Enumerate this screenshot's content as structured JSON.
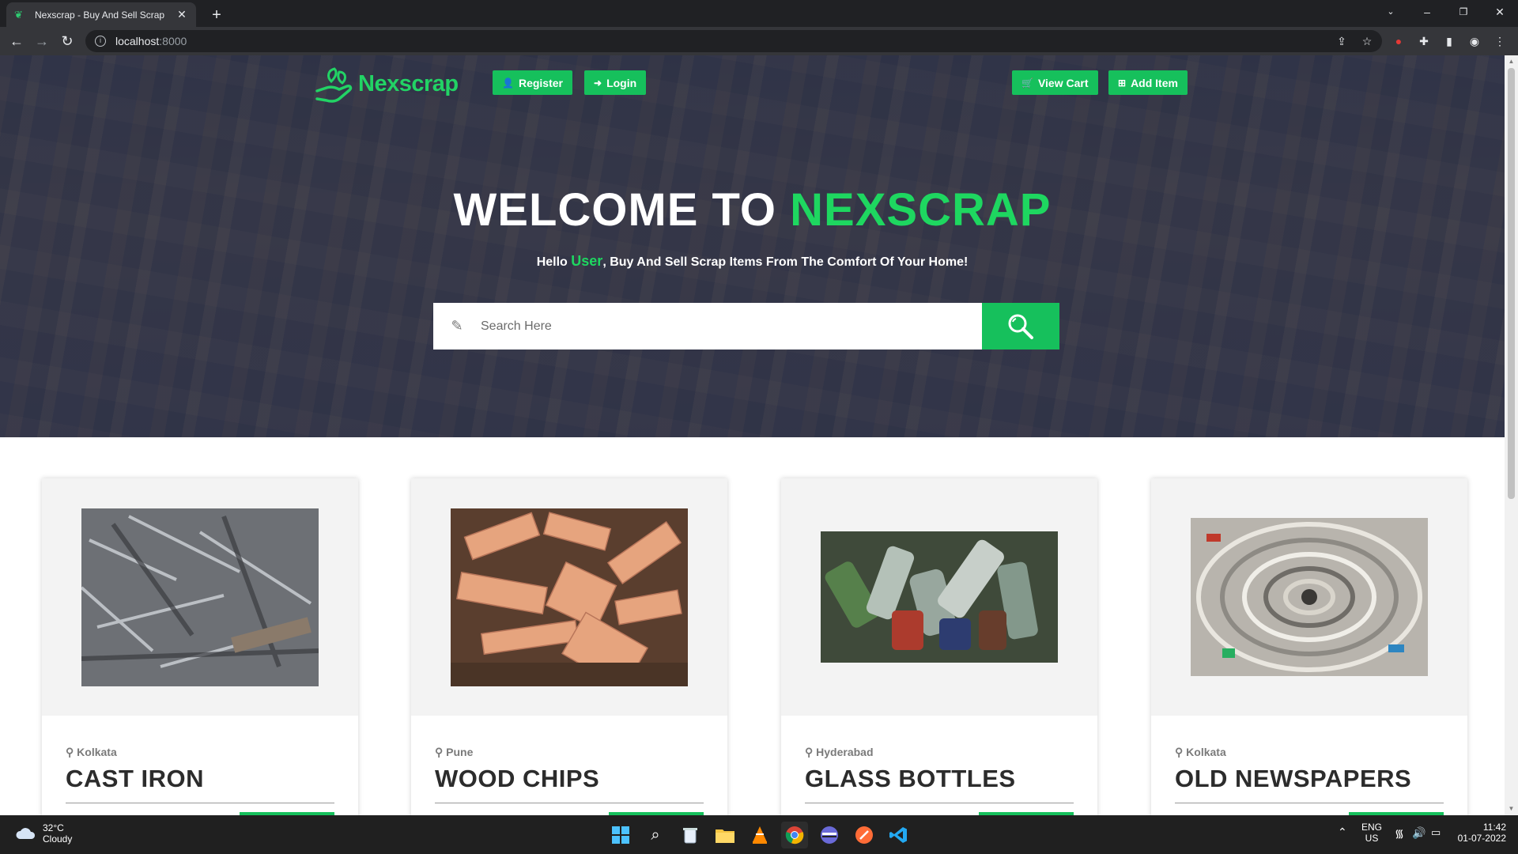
{
  "browser": {
    "tab_title": "Nexscrap - Buy And Sell Scrap",
    "url_host": "localhost",
    "url_port": ":8000"
  },
  "nav": {
    "logo_text": "Nexscrap",
    "register_label": "Register",
    "login_label": "Login",
    "view_cart_label": "View Cart",
    "add_item_label": "Add Item"
  },
  "hero": {
    "welcome_prefix": "WELCOME TO",
    "welcome_brand": "NEXSCRAP",
    "tagline_hello": "Hello",
    "tagline_user": "User",
    "tagline_rest": ", Buy And Sell Scrap Items From The Comfort Of Your Home!",
    "search_placeholder": "Search Here"
  },
  "items": [
    {
      "location": "Kolkata",
      "title": "CAST IRON",
      "image": "scrap-metal-photo"
    },
    {
      "location": "Pune",
      "title": "WOOD CHIPS",
      "image": "wood-chips-photo"
    },
    {
      "location": "Hyderabad",
      "title": "GLASS BOTTLES",
      "image": "glass-bottles-photo"
    },
    {
      "location": "Kolkata",
      "title": "OLD NEWSPAPERS",
      "image": "newspapers-photo"
    }
  ],
  "taskbar": {
    "temp": "32°C",
    "weather": "Cloudy",
    "lang": "ENG",
    "region": "US",
    "time": "11:42",
    "date": "01-07-2022"
  },
  "colors": {
    "accent": "#16c05c",
    "brand_green": "#1ed760"
  }
}
